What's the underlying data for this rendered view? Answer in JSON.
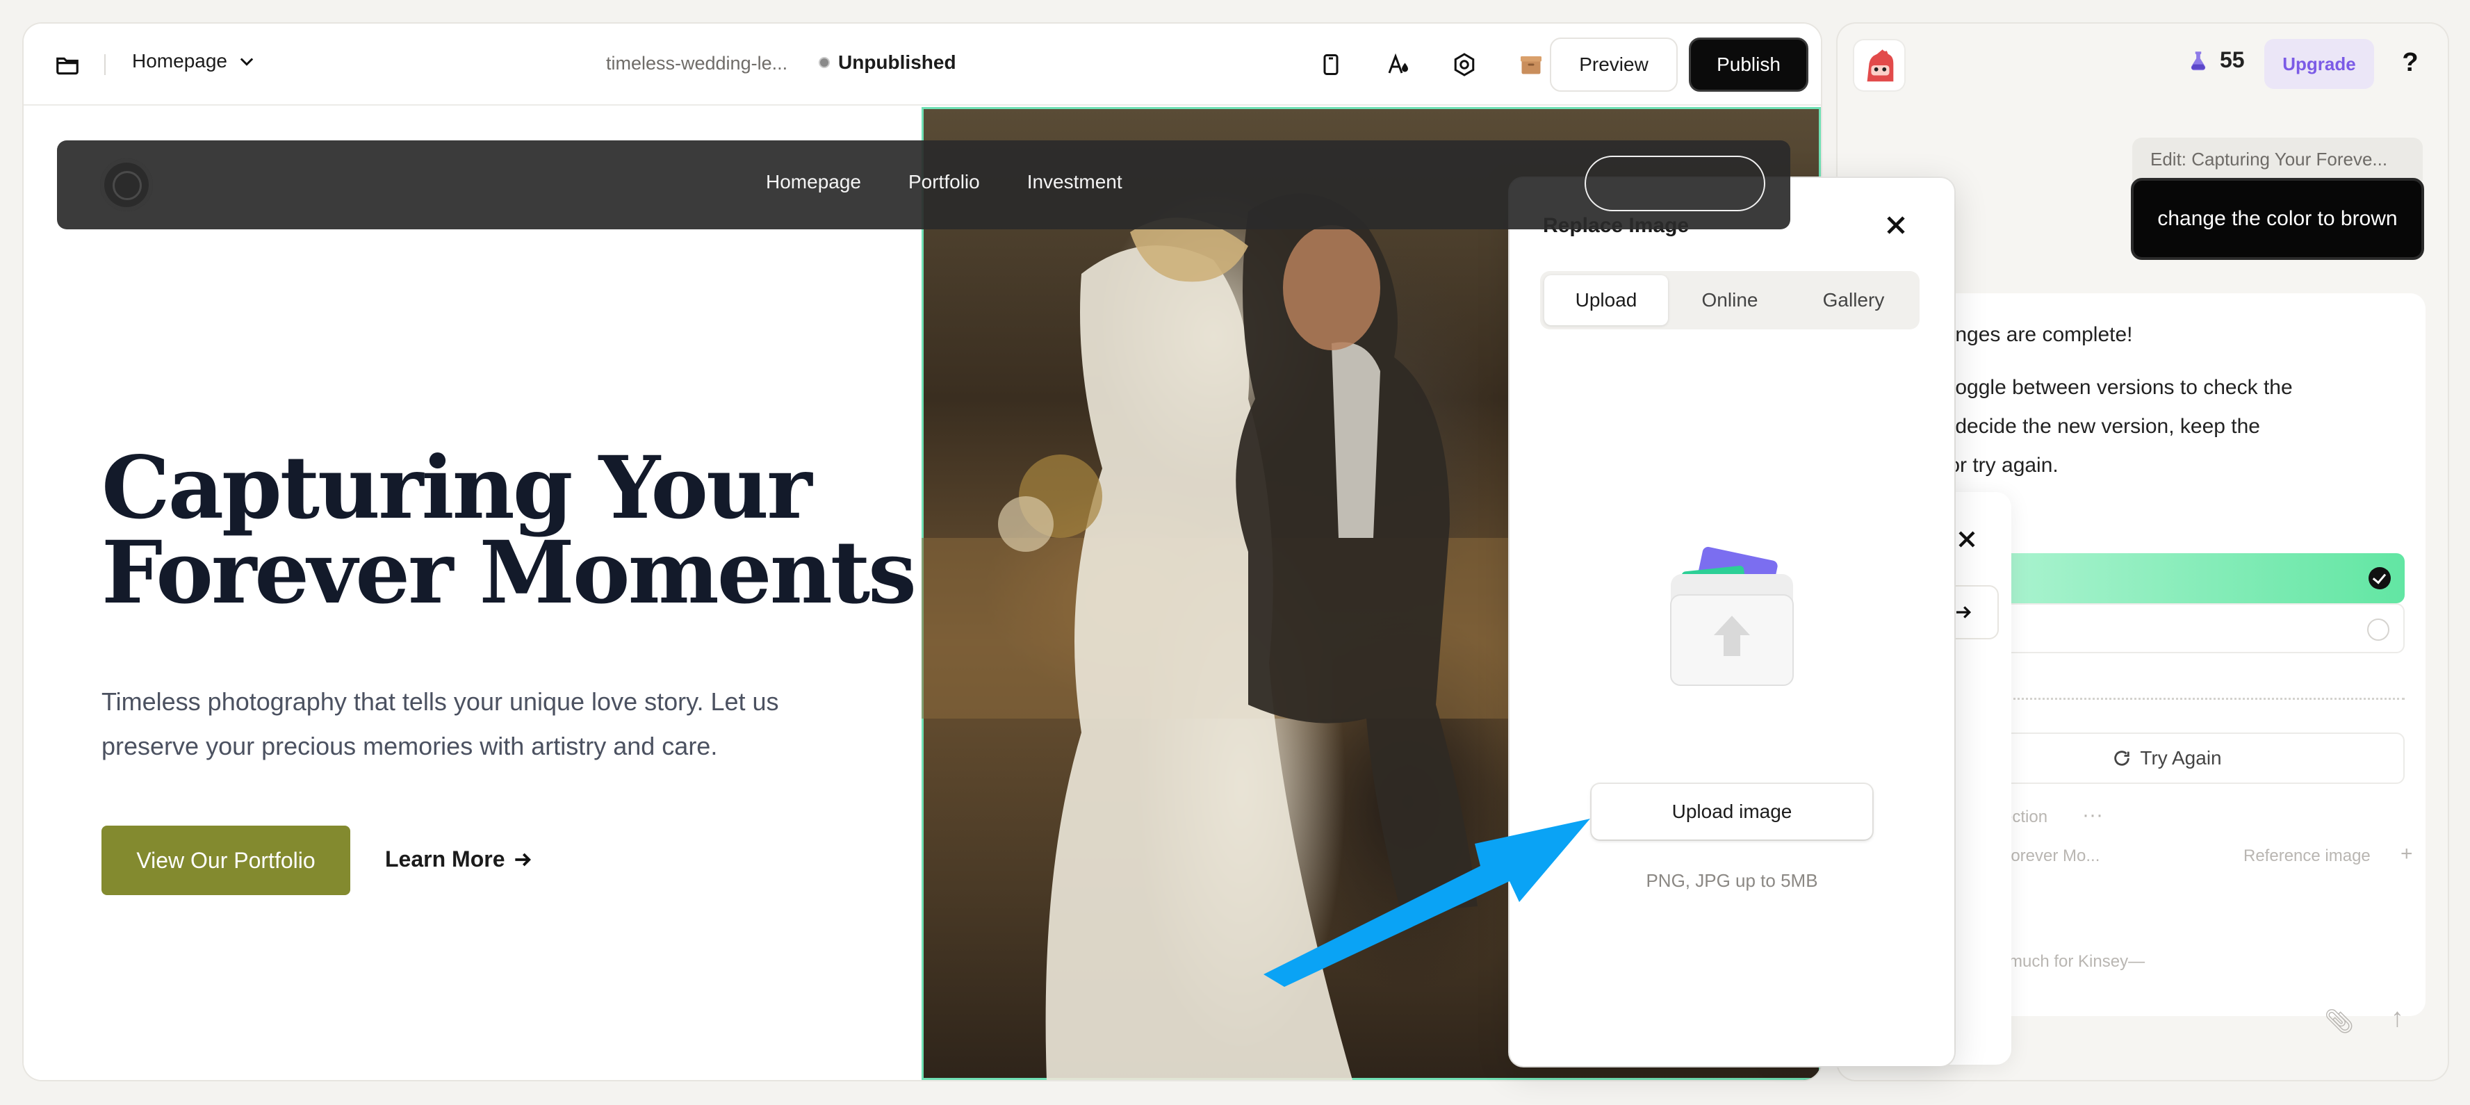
{
  "topbar": {
    "page_label": "Homepage",
    "site_url": "timeless-wedding-le...",
    "status": "Unpublished",
    "preview_label": "Preview",
    "publish_label": "Publish"
  },
  "site": {
    "nav_links": [
      "Homepage",
      "Portfolio",
      "Investment"
    ],
    "hero_title_line1": "Capturing Your",
    "hero_title_line2": "Forever Moments",
    "hero_subtitle": "Timeless photography that tells your unique love story. Let us preserve your precious memories with artistry and care.",
    "primary_cta": "View Our Portfolio",
    "secondary_cta": "Learn More"
  },
  "modal": {
    "title": "Replace Image",
    "tabs": [
      "Upload",
      "Online",
      "Gallery"
    ],
    "active_tab": "Upload",
    "upload_button": "Upload image",
    "hint": "PNG, JPG up to 5MB"
  },
  "chat": {
    "credits": "55",
    "upgrade_label": "Upgrade",
    "help": "?",
    "edit_context": "Edit:  Capturing Your Foreve...",
    "user_message": "change the color to brown",
    "ai_lines": [
      "hanges are complete!",
      "n toggle between versions to check the",
      "to decide the new version, keep the",
      "l, or try again."
    ],
    "try_again": "Try Again",
    "faded_section": "section",
    "faded_ref_title": "r Forever Mo...",
    "faded_ref_image": "Reference image",
    "faded_caption": "much for Kinsey—"
  },
  "colors": {
    "accent_olive": "#838a2f",
    "publish_black": "#0b0b0b",
    "selection_green": "#6fe0b4",
    "upgrade_purple": "#7b5be6",
    "arrow_blue": "#0aa3f5"
  }
}
